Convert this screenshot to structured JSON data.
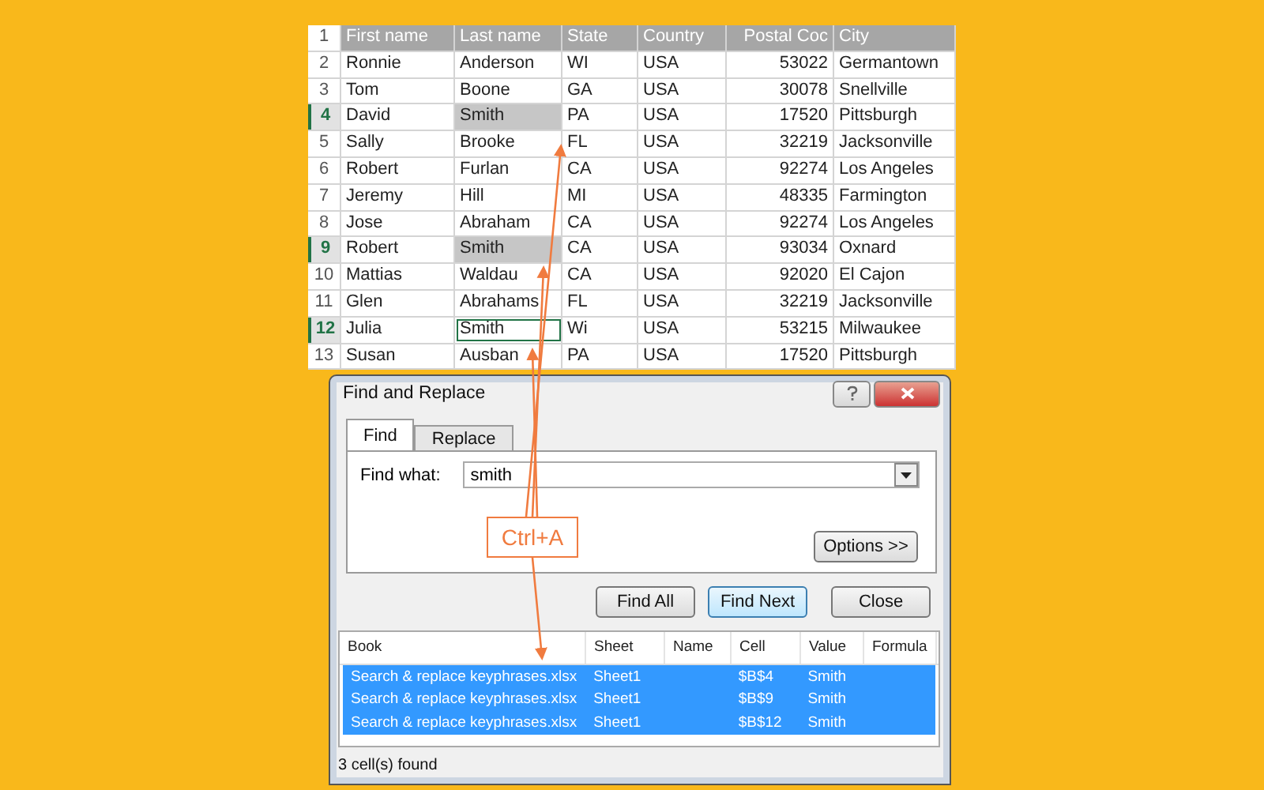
{
  "sheet": {
    "header": {
      "number": "1",
      "cells": [
        "First name",
        "Last name",
        "State",
        "Country",
        "Postal Coc",
        "City"
      ]
    },
    "rows": [
      {
        "number": "2",
        "selected": false,
        "highlighted": false,
        "active": false,
        "cells": [
          "Ronnie",
          "Anderson",
          "WI",
          "USA",
          "53022",
          "Germantown"
        ]
      },
      {
        "number": "3",
        "selected": false,
        "highlighted": false,
        "active": false,
        "cells": [
          "Tom",
          "Boone",
          "GA",
          "USA",
          "30078",
          "Snellville"
        ]
      },
      {
        "number": "4",
        "selected": true,
        "highlighted": true,
        "active": false,
        "cells": [
          "David",
          "Smith",
          "PA",
          "USA",
          "17520",
          "Pittsburgh"
        ]
      },
      {
        "number": "5",
        "selected": false,
        "highlighted": false,
        "active": false,
        "cells": [
          "Sally",
          "Brooke",
          "FL",
          "USA",
          "32219",
          "Jacksonville"
        ]
      },
      {
        "number": "6",
        "selected": false,
        "highlighted": false,
        "active": false,
        "cells": [
          "Robert",
          "Furlan",
          "CA",
          "USA",
          "92274",
          "Los Angeles"
        ]
      },
      {
        "number": "7",
        "selected": false,
        "highlighted": false,
        "active": false,
        "cells": [
          "Jeremy",
          "Hill",
          "MI",
          "USA",
          "48335",
          "Farmington"
        ]
      },
      {
        "number": "8",
        "selected": false,
        "highlighted": false,
        "active": false,
        "cells": [
          "Jose",
          "Abraham",
          "CA",
          "USA",
          "92274",
          "Los Angeles"
        ]
      },
      {
        "number": "9",
        "selected": true,
        "highlighted": true,
        "active": false,
        "cells": [
          "Robert",
          "Smith",
          "CA",
          "USA",
          "93034",
          "Oxnard"
        ]
      },
      {
        "number": "10",
        "selected": false,
        "highlighted": false,
        "active": false,
        "cells": [
          "Mattias",
          "Waldau",
          "CA",
          "USA",
          "92020",
          "El Cajon"
        ]
      },
      {
        "number": "11",
        "selected": false,
        "highlighted": false,
        "active": false,
        "cells": [
          "Glen",
          "Abrahams",
          "FL",
          "USA",
          "32219",
          "Jacksonville"
        ]
      },
      {
        "number": "12",
        "selected": true,
        "highlighted": false,
        "active": true,
        "cells": [
          "Julia",
          "Smith",
          "Wi",
          "USA",
          "53215",
          "Milwaukee"
        ]
      },
      {
        "number": "13",
        "selected": false,
        "highlighted": false,
        "active": false,
        "cells": [
          "Susan",
          "Ausban",
          "PA",
          "USA",
          "17520",
          "Pittsburgh"
        ]
      }
    ]
  },
  "dialog": {
    "title": "Find and Replace",
    "tabs": [
      {
        "label": "Find",
        "selected": true
      },
      {
        "label": "Replace",
        "selected": false
      }
    ],
    "find_what": {
      "label": "Find what:",
      "value": "smith"
    },
    "options_button": "Options >>",
    "buttons": [
      {
        "label": "Find All",
        "selected": false
      },
      {
        "label": "Find Next",
        "selected": true
      },
      {
        "label": "Close",
        "selected": false
      }
    ],
    "results": {
      "columns": [
        "Book",
        "Sheet",
        "Name",
        "Cell",
        "Value",
        "Formula"
      ],
      "rows": [
        {
          "selected": true,
          "book": "Search & replace keyphrases.xlsx",
          "sheet": "Sheet1",
          "cell": "$B$4",
          "value": "Smith"
        },
        {
          "selected": true,
          "book": "Search & replace keyphrases.xlsx",
          "sheet": "Sheet1",
          "cell": "$B$9",
          "value": "Smith"
        },
        {
          "selected": true,
          "book": "Search & replace keyphrases.xlsx",
          "sheet": "Sheet1",
          "cell": "$B$12",
          "value": "Smith"
        }
      ]
    },
    "status": "3 cell(s) found"
  },
  "annotation": {
    "label": "Ctrl+A"
  }
}
